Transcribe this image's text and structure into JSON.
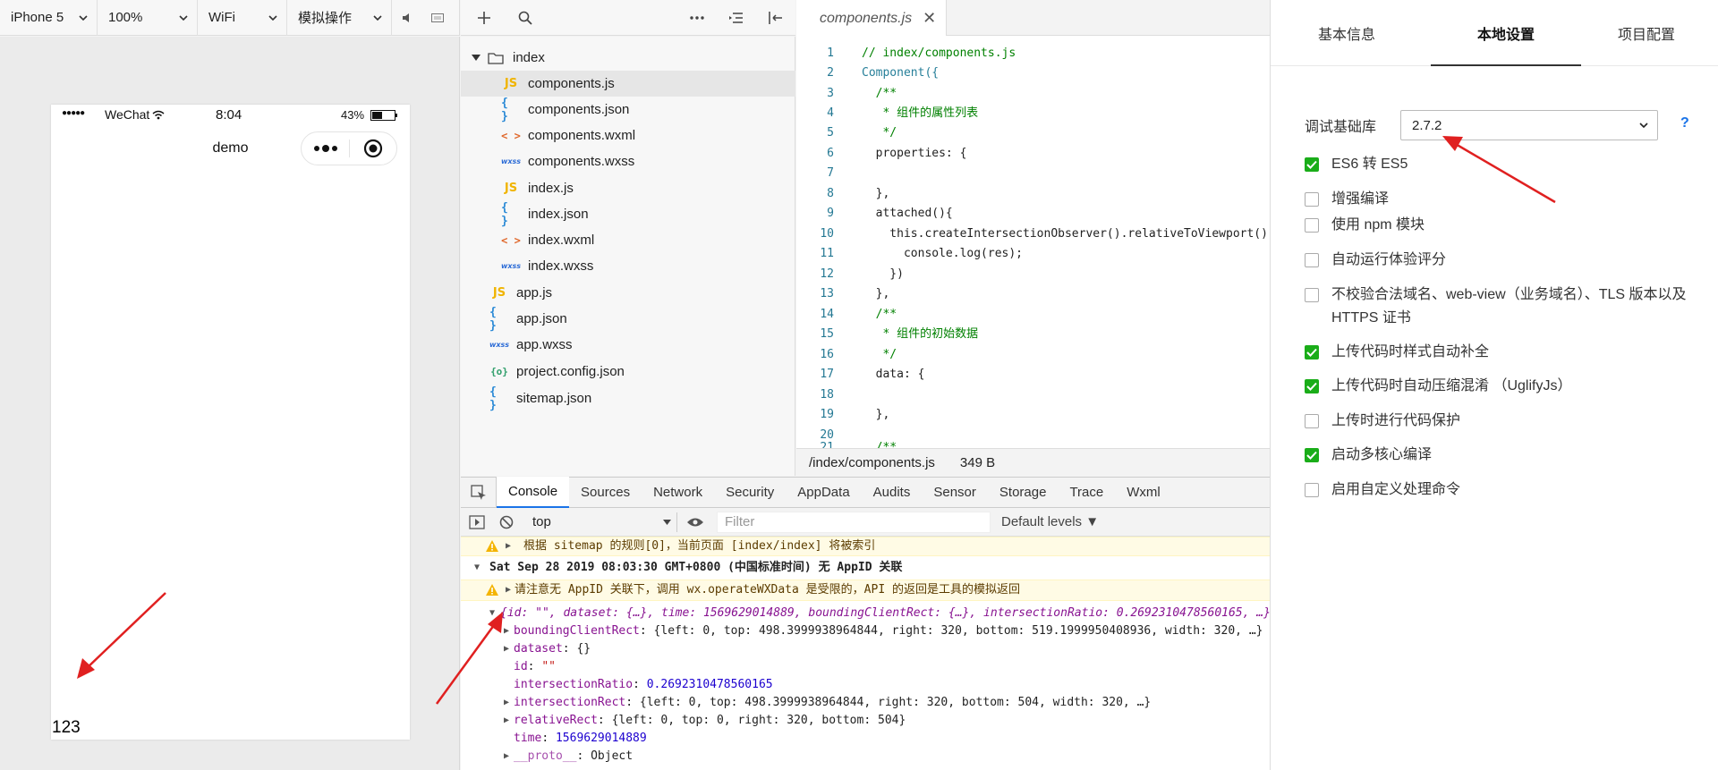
{
  "simulator": {
    "toolbar": {
      "device": "iPhone 5",
      "zoom": "100%",
      "network": "WiFi",
      "operation": "模拟操作"
    },
    "phone": {
      "status_dots": "●●●●●",
      "carrier": "WeChat",
      "time": "8:04",
      "battery": "43%",
      "nav_title": "demo",
      "content_text": "123"
    }
  },
  "file_tree": {
    "items": [
      {
        "name": "index",
        "type": "folder",
        "icon": "folder-icon"
      },
      {
        "name": "components.js",
        "type": "js",
        "icon": "JS",
        "selected": true
      },
      {
        "name": "components.json",
        "type": "json",
        "icon": "{ }"
      },
      {
        "name": "components.wxml",
        "type": "wxml",
        "icon": "< >"
      },
      {
        "name": "components.wxss",
        "type": "wxss",
        "icon": "wxss"
      },
      {
        "name": "index.js",
        "type": "js",
        "icon": "JS"
      },
      {
        "name": "index.json",
        "type": "json",
        "icon": "{ }"
      },
      {
        "name": "index.wxml",
        "type": "wxml",
        "icon": "< >"
      },
      {
        "name": "index.wxss",
        "type": "wxss",
        "icon": "wxss"
      },
      {
        "name": "app.js",
        "type": "js",
        "icon": "JS"
      },
      {
        "name": "app.json",
        "type": "json",
        "icon": "{ }"
      },
      {
        "name": "app.wxss",
        "type": "wxss",
        "icon": "wxss"
      },
      {
        "name": "project.config.json",
        "type": "cfg",
        "icon": "{o}"
      },
      {
        "name": "sitemap.json",
        "type": "json",
        "icon": "{ }"
      }
    ]
  },
  "editor": {
    "tab_label": "components.js",
    "lines": [
      "// index/components.js",
      "Component({",
      "  /**",
      "   * 组件的属性列表",
      "   */",
      "  properties: {",
      "",
      "  },",
      "  attached(){",
      "    this.createIntersectionObserver().relativeToViewport().observe('.text', (res) => {",
      "      console.log(res);",
      "    })",
      "  },",
      "  /**",
      "   * 组件的初始数据",
      "   */",
      "  data: {",
      "",
      "  },",
      "",
      "  /**"
    ],
    "status_path": "/index/components.js",
    "status_size": "349 B"
  },
  "devtools": {
    "tabs": [
      "Console",
      "Sources",
      "Network",
      "Security",
      "AppData",
      "Audits",
      "Sensor",
      "Storage",
      "Trace",
      "Wxml"
    ],
    "context": "top",
    "filter_placeholder": "Filter",
    "levels": "Default levels ▼",
    "console": {
      "warn1": "根据 sitemap 的规则[0]，当前页面 [index/index] 将被索引",
      "group_header": "Sat Sep 28 2019 08:03:30 GMT+0800 (中国标准时间) 无 AppID 关联",
      "warn2": "请注意无 AppID 关联下，调用 wx.operateWXData 是受限的，API 的返回是工具的模拟返回",
      "object_summary": "{id: \"\", dataset: {…}, time: 1569629014889, boundingClientRect: {…}, intersectionRatio: 0.2692310478560165, …}",
      "props": [
        {
          "key": "boundingClientRect",
          "value": "{left: 0, top: 498.3999938964844, right: 320, bottom: 519.1999950408936, width: 320, …}",
          "expandable": true
        },
        {
          "key": "dataset",
          "value": "{}",
          "expandable": true
        },
        {
          "key": "id",
          "value": "\"\"",
          "expandable": false
        },
        {
          "key": "intersectionRatio",
          "value": "0.2692310478560165",
          "expandable": false
        },
        {
          "key": "intersectionRect",
          "value": "{left: 0, top: 498.3999938964844, right: 320, bottom: 504, width: 320, …}",
          "expandable": true
        },
        {
          "key": "relativeRect",
          "value": "{left: 0, top: 0, right: 320, bottom: 504}",
          "expandable": true
        },
        {
          "key": "time",
          "value": "1569629014889",
          "expandable": false
        },
        {
          "key": "__proto__",
          "value": "Object",
          "expandable": true
        }
      ]
    }
  },
  "settings": {
    "tabs": [
      "基本信息",
      "本地设置",
      "项目配置"
    ],
    "active_tab": "本地设置",
    "lib_label": "调试基础库",
    "lib_version": "2.7.2",
    "help": "?",
    "options": [
      {
        "label": "ES6 转 ES5",
        "checked": true
      },
      {
        "label": "增强编译",
        "checked": false
      },
      {
        "label": "使用 npm 模块",
        "checked": false
      },
      {
        "label": "自动运行体验评分",
        "checked": false
      },
      {
        "label": "不校验合法域名、web-view（业务域名）、TLS 版本以及 HTTPS 证书",
        "checked": false
      },
      {
        "label": "上传代码时样式自动补全",
        "checked": true
      },
      {
        "label": "上传代码时自动压缩混淆 （UglifyJs）",
        "checked": true
      },
      {
        "label": "上传时进行代码保护",
        "checked": false
      },
      {
        "label": "启动多核心编译",
        "checked": true
      },
      {
        "label": "启用自定义处理命令",
        "checked": false
      }
    ]
  },
  "colors": {
    "checkbox_on": "#1aad19",
    "annotation_arrow": "#e02020",
    "devtools_active": "#1a73e8"
  }
}
